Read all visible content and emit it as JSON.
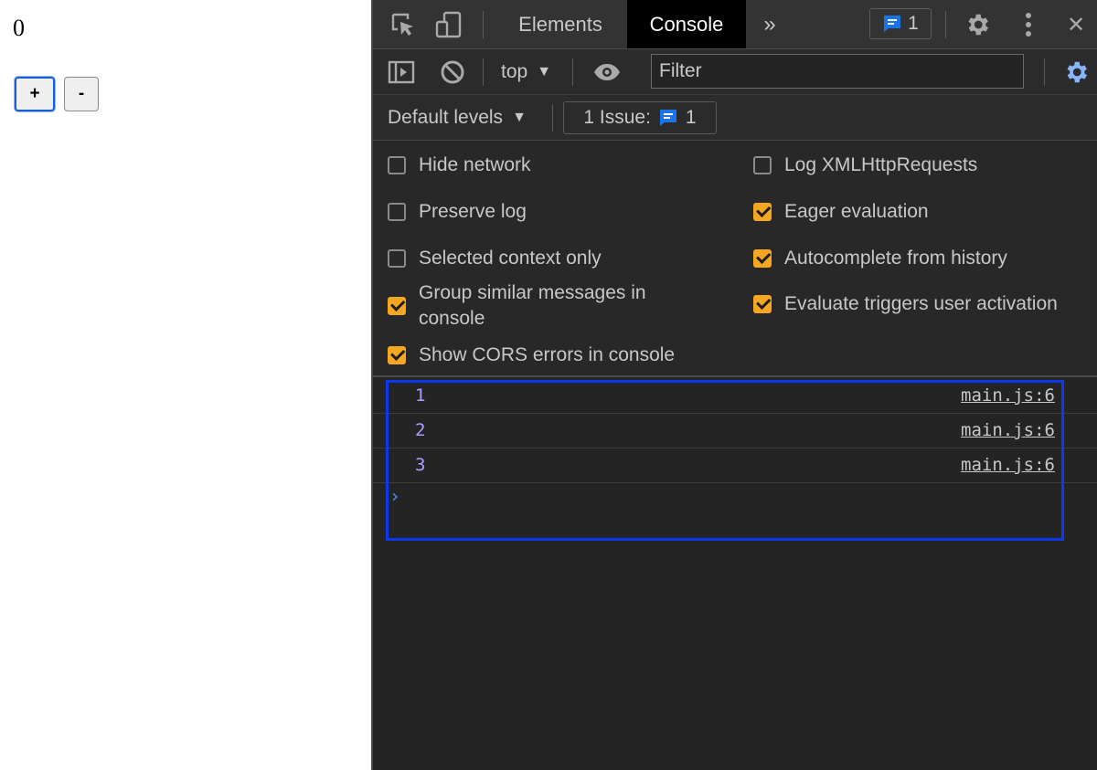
{
  "page": {
    "counter_value": "0",
    "plus_label": "+",
    "minus_label": "-"
  },
  "devtools": {
    "tabs": [
      {
        "label": "Elements",
        "active": false
      },
      {
        "label": "Console",
        "active": true
      }
    ],
    "more_tabs": "»",
    "issues_badge_count": "1",
    "close_glyph": "✕",
    "context_label": "top",
    "filter_placeholder": "Filter",
    "levels_label": "Default levels",
    "issues_button": {
      "text": "1 Issue:",
      "count": "1"
    },
    "settings": [
      {
        "label": "Hide network",
        "checked": false
      },
      {
        "label": "Log XMLHttpRequests",
        "checked": false
      },
      {
        "label": "Preserve log",
        "checked": false
      },
      {
        "label": "Eager evaluation",
        "checked": true
      },
      {
        "label": "Selected context only",
        "checked": false
      },
      {
        "label": "Autocomplete from history",
        "checked": true
      },
      {
        "label": "Group similar messages in console",
        "checked": true
      },
      {
        "label": "Evaluate triggers user activation",
        "checked": true
      },
      {
        "label": "Show CORS errors in console",
        "checked": true
      }
    ],
    "messages": [
      {
        "value": "1",
        "source": "main.js:6"
      },
      {
        "value": "2",
        "source": "main.js:6"
      },
      {
        "value": "3",
        "source": "main.js:6"
      }
    ],
    "prompt": "›"
  },
  "colors": {
    "checkbox_on": "#f5a623",
    "highlight": "#1037f0",
    "log_value": "#a9a0ff",
    "prompt": "#4c8df6"
  }
}
